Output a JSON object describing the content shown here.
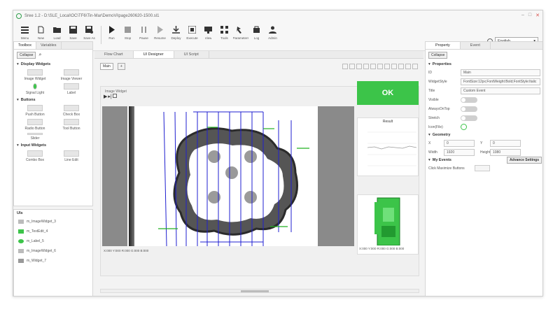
{
  "window": {
    "title": "Sree 1.2 - D:\\SLE_Local\\OC\\TF6\\Tin-Mar\\DemoVi\\page260620-1500.sl1"
  },
  "toolbar": {
    "buttons": [
      {
        "label": "Menu",
        "icon": "menu-icon"
      },
      {
        "label": "New",
        "icon": "new-icon"
      },
      {
        "label": "Load",
        "icon": "folder-icon"
      },
      {
        "label": "Save",
        "icon": "save-icon"
      },
      {
        "label": "Save As",
        "icon": "save-as-icon"
      },
      {
        "label": "Run",
        "icon": "play-icon"
      },
      {
        "label": "Stop",
        "icon": "stop-icon"
      },
      {
        "label": "Pause",
        "icon": "pause-icon"
      },
      {
        "label": "Resume",
        "icon": "resume-icon"
      },
      {
        "label": "Deploy",
        "icon": "deploy-icon"
      },
      {
        "label": "Execute",
        "icon": "execute-icon"
      },
      {
        "label": "View",
        "icon": "view-icon"
      },
      {
        "label": "Tools",
        "icon": "tools-icon"
      },
      {
        "label": "Parameters",
        "icon": "parameters-icon"
      },
      {
        "label": "Log",
        "icon": "log-icon"
      },
      {
        "label": "Admin",
        "icon": "admin-icon"
      }
    ],
    "language": "English"
  },
  "left_panel": {
    "tabs": [
      "Toolbox",
      "Variables"
    ],
    "collapse_label": "Collapse",
    "groups": [
      {
        "name": "Display Widgets",
        "items": [
          "Image Widget",
          "Image Viewer",
          "Signal Light",
          "Label"
        ]
      },
      {
        "name": "Buttons",
        "items": [
          "Push Button",
          "Check Box",
          "Radio Button",
          "Tool Button",
          "Slider"
        ]
      },
      {
        "name": "Input Widgets",
        "items": [
          "Combo Box",
          "Line Edit"
        ]
      }
    ],
    "ui_title": "UIs",
    "ui_items": [
      "m_ImageWidget_3",
      "m_TextEdit_4",
      "m_Label_5",
      "m_ImageWidget_6",
      "m_Widget_7"
    ]
  },
  "center": {
    "tabs": [
      "Flow Chart",
      "UI Designer",
      "UI Script"
    ],
    "page_tab": "Main",
    "add_page_label": "+",
    "image_widget_title": "Image Widget",
    "image_status": "X:000 Y:000 R:000 G:000 B:000",
    "ok_label": "OK",
    "chart_title": "Result",
    "bottom_status": "X:000 Y:000 R:000 G:000 B:000"
  },
  "right_panel": {
    "tabs": [
      "Property",
      "Event"
    ],
    "collapse_label": "Collapse",
    "sections": {
      "properties": "Properties",
      "geometry": "Geometry",
      "my_events": "My Events"
    },
    "props": [
      {
        "key": "ID",
        "value": "Main"
      },
      {
        "key": "WidgetStyle",
        "value": "FontSize:12px;FontWeight:Bold;FontStyle:Italic"
      },
      {
        "key": "Title",
        "value": "Custom Event"
      }
    ],
    "toggles": [
      "Visible",
      "AlwaysOnTop",
      "Stretch"
    ],
    "icon_key": "Icon(File)",
    "geometry": {
      "x": "0",
      "y": "0",
      "width": "1920",
      "height": "1080",
      "x_label": "X",
      "y_label": "Y",
      "w_label": "Width",
      "h_label": "Height"
    },
    "advance_settings": "Advance Settings",
    "event_label": "Click Maximize Buttons"
  },
  "colors": {
    "accent": "#3cc449",
    "blue_lines": "#1f1fd0",
    "green_lines": "#22b022"
  }
}
